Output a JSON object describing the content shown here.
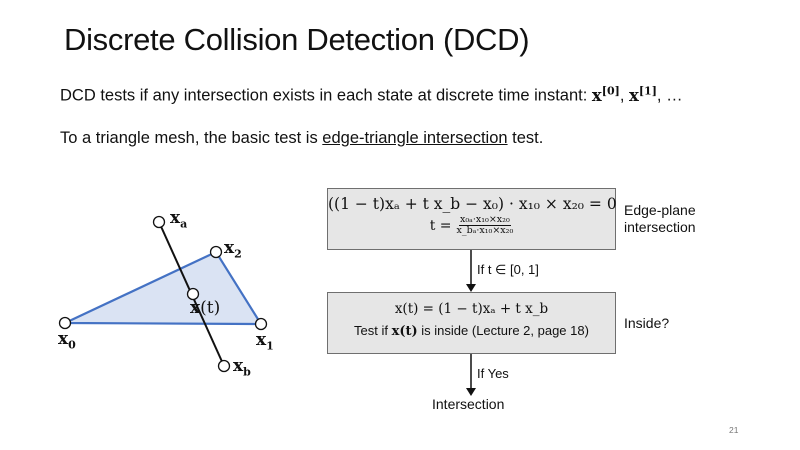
{
  "slide": {
    "title": "Discrete Collision Detection (DCD)",
    "line1_text": "DCD tests if any intersection exists in each state at discrete time instant: ",
    "line1_x": "x",
    "line1_sup0": "[0]",
    "line1_sep": ", ",
    "line1_x2": "x",
    "line1_sup1": "[1]",
    "line1_tail": ", …",
    "line2_pre": "To a triangle mesh, the basic test is ",
    "line2_link": "edge-triangle intersection",
    "line2_post": " test.",
    "page_number": "21"
  },
  "diagram": {
    "labels": {
      "xa": "a",
      "x2": "2",
      "xt": "(t)",
      "x0": "0",
      "x1": "1",
      "xb": "b",
      "bold_x": "x"
    },
    "triangle_fill": "#dae3f3",
    "triangle_stroke": "#4472c4"
  },
  "flow": {
    "box1_eq": "((1 − t)xₐ + t x_b − x₀) · x₁₀ × x₂₀ = 0",
    "box1_t": "t =",
    "box1_num": "x₀ₐ·x₁₀×x₂₀",
    "box1_den": "x_bₐ·x₁₀×x₂₀",
    "box1_side_line1": "Edge-plane",
    "box1_side_line2": "intersection",
    "cond1": "If t ∈ [0, 1]",
    "box2_eq": "x(t) = (1 − t)xₐ + t x_b",
    "box2_test_pre": "Test if ",
    "box2_test_var": "x(t)",
    "box2_test_post": " is inside (Lecture 2, page 18)",
    "box2_side": "Inside?",
    "cond2": "If Yes",
    "result": "Intersection"
  }
}
